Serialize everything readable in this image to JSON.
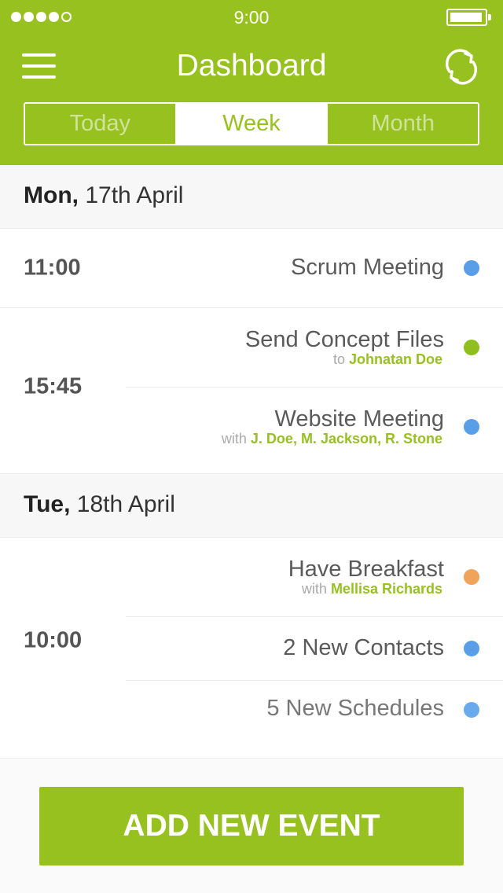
{
  "status_bar": {
    "time": "9:00",
    "signal_bars_filled": 4,
    "signal_bars_total": 5,
    "battery_icon": "battery-icon"
  },
  "header": {
    "title": "Dashboard",
    "menu_icon": "hamburger-menu-icon",
    "refresh_icon": "refresh-icon",
    "accent_color": "#97c11f"
  },
  "tabs": [
    {
      "label": "Today",
      "active": false
    },
    {
      "label": "Week",
      "active": true
    },
    {
      "label": "Month",
      "active": false
    }
  ],
  "days": [
    {
      "weekday": "Mon,",
      "date": "17th April",
      "groups": [
        {
          "time": "11:00",
          "events": [
            {
              "title": "Scrum Meeting",
              "prefix": "",
              "people": "",
              "color": "#5a9ee8"
            }
          ]
        },
        {
          "time": "15:45",
          "events": [
            {
              "title": "Send Concept Files",
              "prefix": "to",
              "people": "Johnatan Doe",
              "color": "#8ebf1f"
            },
            {
              "title": "Website Meeting",
              "prefix": "with",
              "people": "J. Doe, M. Jackson, R. Stone",
              "color": "#5a9ee8"
            }
          ]
        }
      ]
    },
    {
      "weekday": "Tue,",
      "date": "18th April",
      "groups": [
        {
          "time": "10:00",
          "events": [
            {
              "title": "Have Breakfast",
              "prefix": "with",
              "people": "Mellisa Richards",
              "color": "#f0a35a"
            },
            {
              "title": "2 New Contacts",
              "prefix": "",
              "people": "",
              "color": "#5a9ee8"
            },
            {
              "title": "5 New Schedules",
              "prefix": "",
              "people": "",
              "color": "#6aa9ec"
            }
          ]
        }
      ]
    }
  ],
  "add_button": {
    "label": "ADD NEW EVENT"
  }
}
